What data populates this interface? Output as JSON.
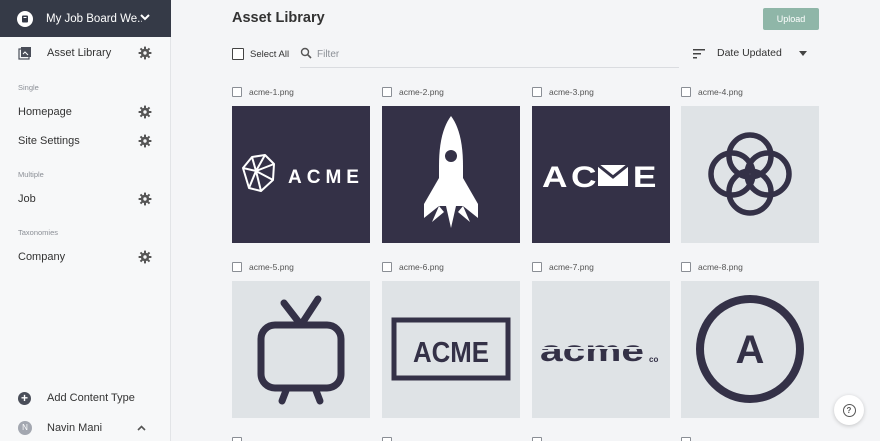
{
  "site": {
    "name": "My Job Board We...",
    "header_bg": "#353a47"
  },
  "sidebar": {
    "asset_library": "Asset Library",
    "sections": [
      {
        "label": "Single",
        "items": [
          "Homepage",
          "Site Settings"
        ]
      },
      {
        "label": "Multiple",
        "items": [
          "Job"
        ]
      },
      {
        "label": "Taxonomies",
        "items": [
          "Company"
        ]
      }
    ],
    "add_content_type": "Add Content Type",
    "user": {
      "initial": "N",
      "name": "Navin Mani"
    }
  },
  "main": {
    "title": "Asset Library",
    "upload_label": "Upload",
    "select_all_label": "Select All",
    "filter_placeholder": "Filter",
    "sort_label": "Date Updated",
    "assets": [
      {
        "filename": "acme-1.png",
        "bg": "dark"
      },
      {
        "filename": "acme-2.png",
        "bg": "dark"
      },
      {
        "filename": "acme-3.png",
        "bg": "dark"
      },
      {
        "filename": "acme-4.png",
        "bg": "light"
      },
      {
        "filename": "acme-5.png",
        "bg": "light"
      },
      {
        "filename": "acme-6.png",
        "bg": "light"
      },
      {
        "filename": "acme-7.png",
        "bg": "light"
      },
      {
        "filename": "acme-8.png",
        "bg": "light"
      }
    ],
    "logo_text": {
      "acme": "ACME",
      "acme_lower": "acme",
      "co": "co",
      "a": "A"
    }
  },
  "colors": {
    "accent": "#8fb6a8",
    "logo_dark": "#343147",
    "tile_light": "#dfe3e6"
  }
}
